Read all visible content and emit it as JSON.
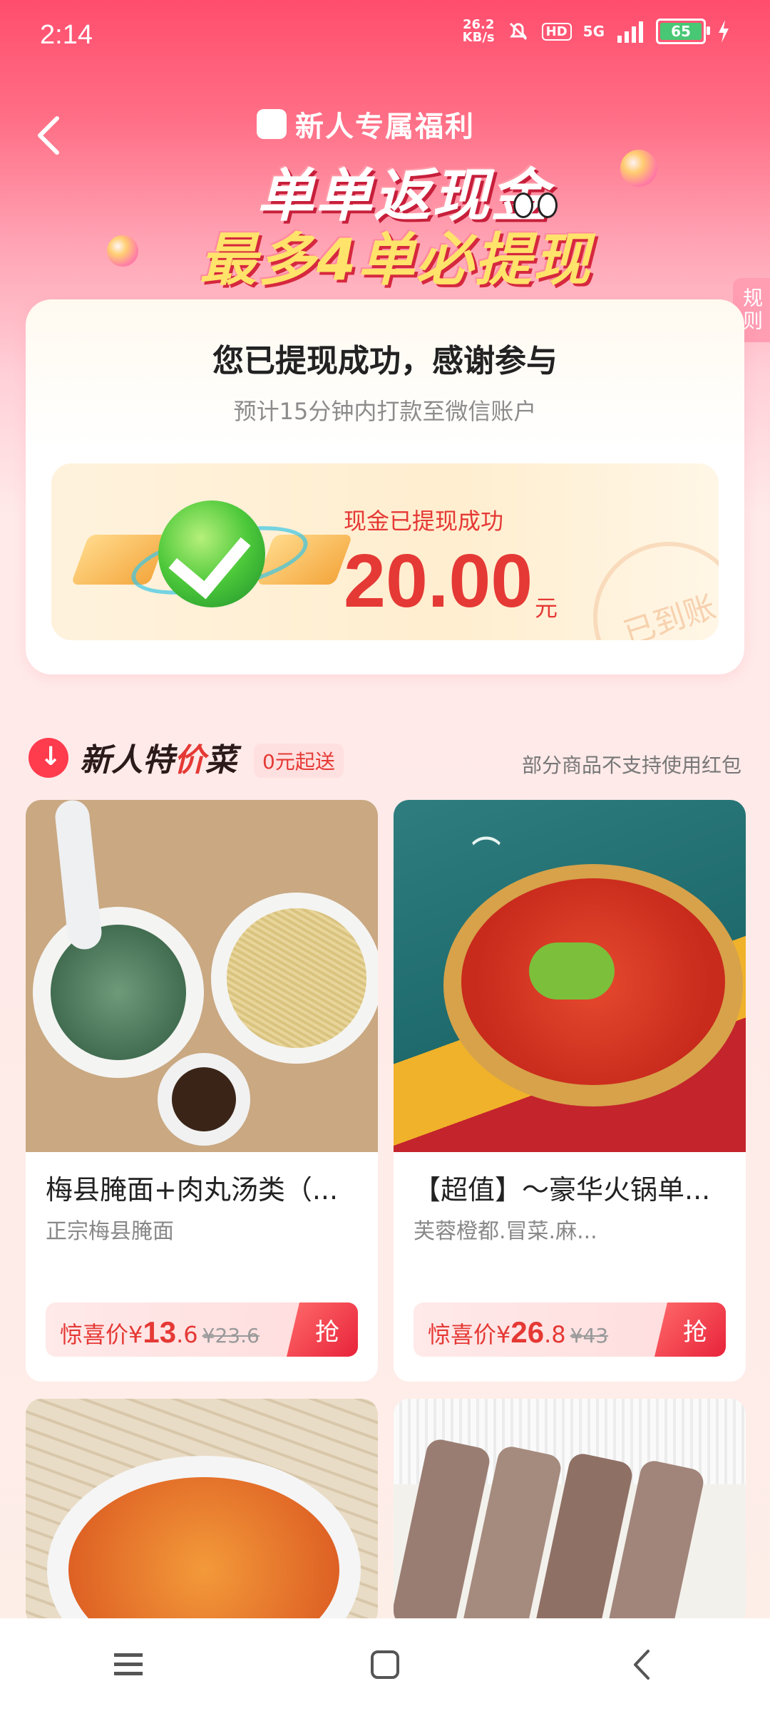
{
  "status": {
    "time": "2:14",
    "speed_value": "26.2",
    "speed_unit": "KB/s",
    "hd": "HD",
    "network": "5G",
    "battery": "65"
  },
  "banner": {
    "title": "新人专属福利",
    "line1": "单单返现金",
    "line2": "最多4单必提现",
    "rules": "规则"
  },
  "success": {
    "heading": "您已提现成功，感谢参与",
    "sub": "预计15分钟内打款至微信账户",
    "cash_label": "现金已提现成功",
    "amount": "20.00",
    "unit": "元",
    "stamp": "已到账"
  },
  "section": {
    "title_part1": "新人特",
    "title_part2": "价",
    "title_part3": "菜",
    "tag": "0元起送",
    "note": "部分商品不支持使用红包"
  },
  "products": [
    {
      "name": "梅县腌面+肉丸汤类（...",
      "shop": "正宗梅县腌面",
      "price_label": "惊喜价¥",
      "price_int": "13",
      "price_dec": ".6",
      "orig": "¥23.6",
      "btn": "抢"
    },
    {
      "name": "【超值】～豪华火锅单...",
      "shop": "芙蓉橙都.冒菜.麻...",
      "price_label": "惊喜价¥",
      "price_int": "26",
      "price_dec": ".8",
      "orig": "¥43",
      "btn": "抢"
    }
  ],
  "colors": {
    "accent": "#e53935",
    "banner_top": "#ff4d6d"
  }
}
